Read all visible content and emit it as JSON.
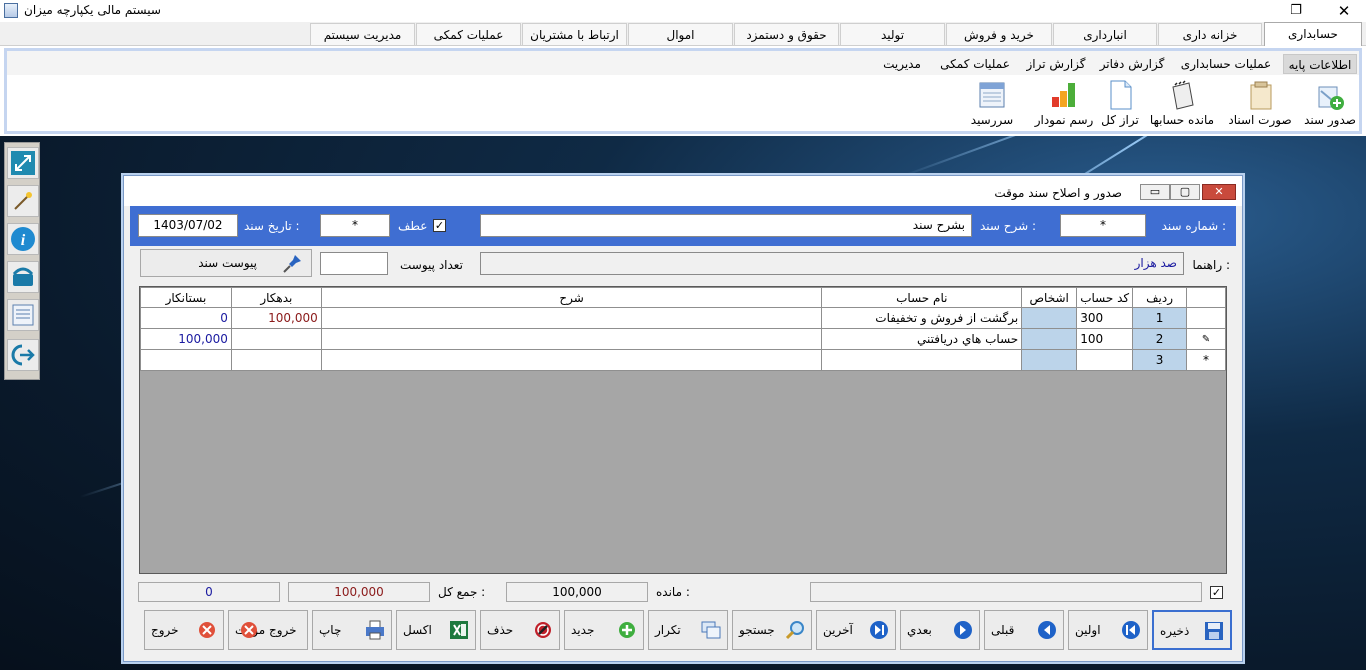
{
  "window": {
    "title": "سیستم مالی یکپارچه میزان",
    "restore_glyph": "❐",
    "close_glyph": "✕"
  },
  "top_tabs": [
    "حسابداری",
    "خزانه داری",
    "انبارداری",
    "خرید و فروش",
    "تولید",
    "حقوق و دستمزد",
    "اموال",
    "ارتباط با مشتریان",
    "عملیات کمکی",
    "مدیریت سیستم"
  ],
  "sub_tabs": [
    "اطلاعات پایه",
    "عملیات حسابداری",
    "گزارش دفاتر",
    "گزارش تراز",
    "عملیات کمکی",
    "مدیریت"
  ],
  "ribbon_buttons": [
    {
      "label": "صدور سند",
      "icon": "add-document-icon"
    },
    {
      "label": "صورت اسناد",
      "icon": "documents-list-icon"
    },
    {
      "label": "مانده حسابها",
      "icon": "notebook-icon"
    },
    {
      "label": "تراز کل",
      "icon": "page-icon"
    },
    {
      "label": "رسم نمودار",
      "icon": "bar-chart-icon"
    },
    {
      "label": "سررسید",
      "icon": "calendar-icon"
    }
  ],
  "quickbar": [
    "resize-icon",
    "wand-icon",
    "info-icon",
    "phone-icon",
    "notes-icon",
    "exit-icon"
  ],
  "dialog": {
    "title": "صدور و اصلاح سند موقت",
    "btn_min": "▭",
    "btn_max": "▢",
    "btn_close": "✕",
    "doc_number_label": "شماره سند :",
    "doc_number_value": "*",
    "desc_label": "شرح سند :",
    "desc_value": "بشرح سند",
    "atf_label": "عطف",
    "atf_checked": "✓",
    "atf_value": "*",
    "date_label": "تاریخ سند :",
    "date_value": "1403/07/02",
    "guide_label": "راهنما :",
    "guide_value": "صد هزار",
    "attach_count_label": "تعداد پیوست",
    "attach_count_value": "",
    "attach_button": "پیوست سند"
  },
  "grid": {
    "headers": {
      "row": "ردیف",
      "code": "کد حساب",
      "persons": "اشخاص",
      "name": "نام حساب",
      "desc": "شرح",
      "debit": "بدهکار",
      "credit": "بستانکار"
    },
    "rows": [
      {
        "indicator": "",
        "row": "1",
        "code": "300",
        "persons": "",
        "name": "برگشت از فروش و تخفیفات",
        "desc": "",
        "debit": "100,000",
        "credit": "0"
      },
      {
        "indicator": "✎",
        "row": "2",
        "code": "100",
        "persons": "",
        "name": "حساب هاي دريافتني",
        "desc": "",
        "debit": "",
        "credit": "100,000"
      },
      {
        "indicator": "*",
        "row": "3",
        "code": "",
        "persons": "",
        "name": "",
        "desc": "",
        "debit": "",
        "credit": ""
      }
    ]
  },
  "totals": {
    "check": "✓",
    "balance_label": "مانده :",
    "balance_value": "100,000",
    "sum_label": "جمع کل :",
    "debit_total": "100,000",
    "credit_total": "0"
  },
  "buttons": [
    {
      "label": "ذخیره",
      "icon": "save-icon"
    },
    {
      "label": "اولین",
      "icon": "first-icon"
    },
    {
      "label": "قبلی",
      "icon": "previous-icon"
    },
    {
      "label": "بعدي",
      "icon": "next-icon"
    },
    {
      "label": "آخرین",
      "icon": "last-icon"
    },
    {
      "label": "جستجو",
      "icon": "search-icon"
    },
    {
      "label": "تکرار",
      "icon": "repeat-icon"
    },
    {
      "label": "جدید",
      "icon": "new-icon"
    },
    {
      "label": "حذف",
      "icon": "delete-icon"
    },
    {
      "label": "اکسل",
      "icon": "excel-icon"
    },
    {
      "label": "چاپ",
      "icon": "print-icon"
    },
    {
      "label": "خروج موقت",
      "icon": "temp-exit-icon"
    },
    {
      "label": "خروج",
      "icon": "exit-icon"
    }
  ],
  "colors": {
    "accent_blue": "#3f6ed2",
    "debit_red": "#8b1a1a",
    "credit_blue": "#1a1aa0",
    "persons_cell": "#bcd4ea"
  }
}
